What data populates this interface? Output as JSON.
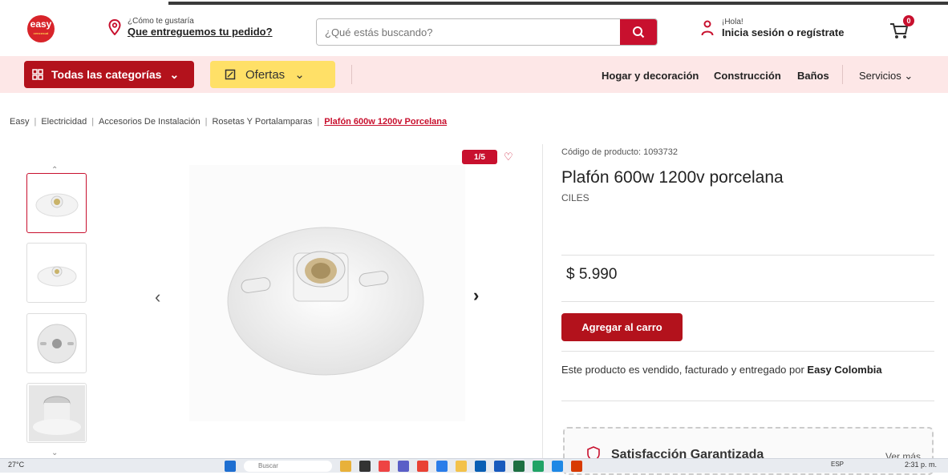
{
  "header": {
    "logo_text": "easy",
    "logo_sub": "cencosud",
    "delivery_small": "¿Cómo te gustaría",
    "delivery_big": "Que entreguemos tu pedido?",
    "search_placeholder": "¿Qué estás buscando?",
    "login_small": "¡Hola!",
    "login_big": "Inicia sesión o regístrate",
    "cart_count": "0"
  },
  "nav": {
    "categories": "Todas las categorías",
    "ofertas": "Ofertas",
    "links": [
      "Hogar y decoración",
      "Construcción",
      "Baños"
    ],
    "servicios": "Servicios"
  },
  "breadcrumb": [
    "Easy",
    "Electricidad",
    "Accesorios De Instalación",
    "Rosetas Y Portalamparas",
    "Plafón 600w 1200v Porcelana"
  ],
  "gallery": {
    "counter": "1/5"
  },
  "product": {
    "code": "Código de producto: 1093732",
    "title": "Plafón 600w 1200v porcelana",
    "brand": "CILES",
    "price": "$ 5.990",
    "add_to_cart": "Agregar al carro",
    "seller_text": "Este producto es vendido, facturado y entregado por ",
    "seller_name": "Easy Colombia",
    "satisfaction": "Satisfacción Garantizada",
    "see_more": "Ver más"
  },
  "taskbar": {
    "temperature": "27°C",
    "search": "Buscar",
    "lang": "ESP",
    "time": "2:31 p. m."
  },
  "colors": {
    "brand_red": "#c8102e",
    "nav_bg": "#fde7e7",
    "ofertas_yellow": "#ffe067"
  }
}
